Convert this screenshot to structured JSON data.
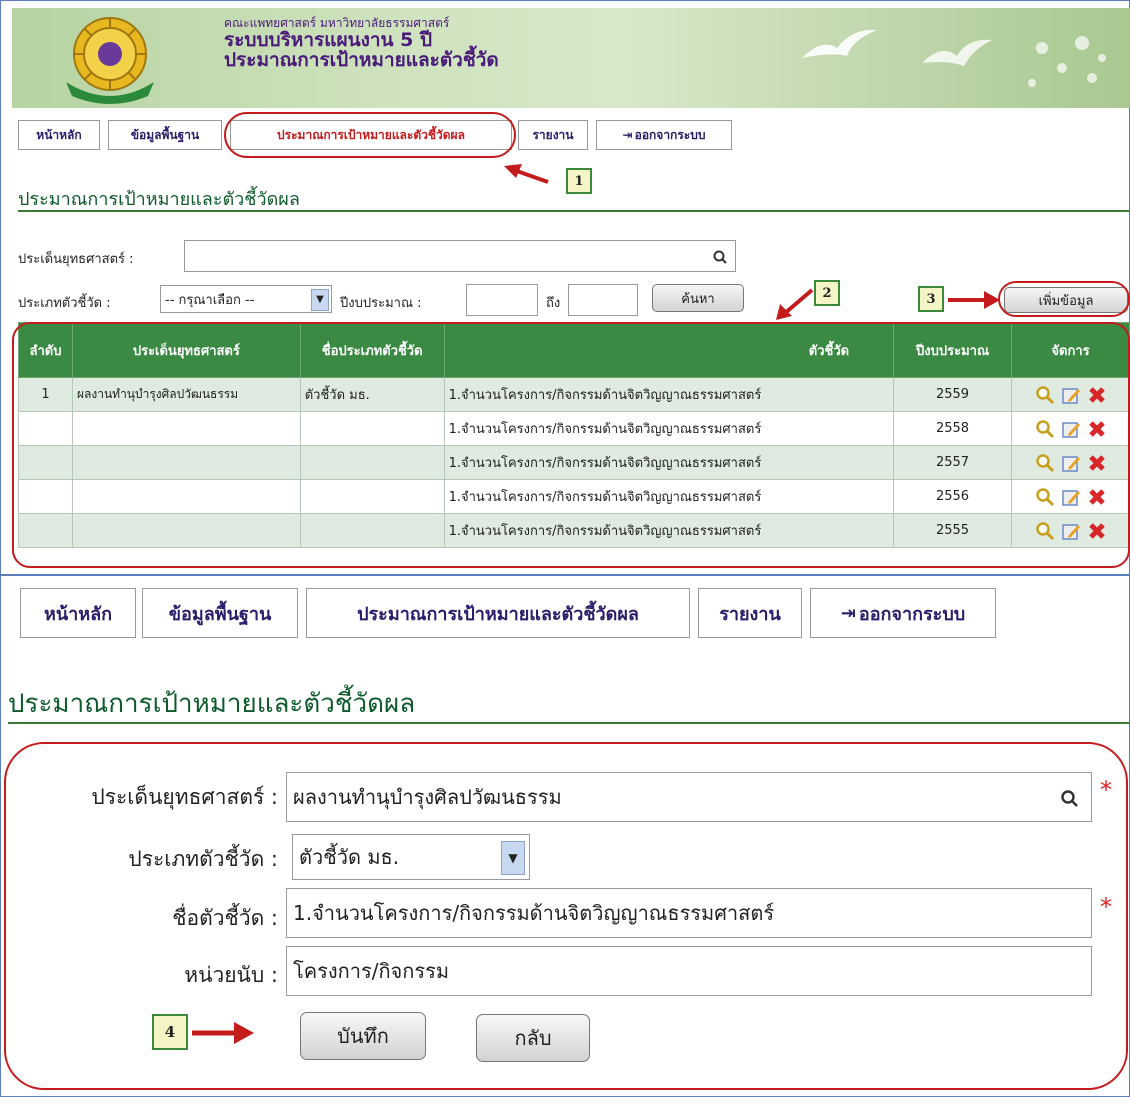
{
  "banner": {
    "faculty": "คณะแพทยศาสตร์ มหาวิทยาลัยธรรมศาสตร์",
    "system": "ระบบบริหารแผนงาน 5 ปี",
    "subtitle": "ประมาณการเป้าหมายและตัวชี้วัด"
  },
  "nav_small": [
    "หน้าหลัก",
    "ข้อมูลพื้นฐาน",
    "ประมาณการเป้าหมายและตัวชี้วัดผล",
    "รายงาน",
    "ออกจากระบบ"
  ],
  "list_page": {
    "title": "ประมาณการเป้าหมายและตัวชี้วัดผล",
    "strategy_label": "ประเด็นยุทธศาสตร์ :",
    "type_label": "ประเภทตัวชี้วัด :",
    "type_value": "-- กรุณาเลือก --",
    "year_label": "ปีงบประมาณ :",
    "to_label": "ถึง",
    "search_button": "ค้นหา",
    "add_button": "เพิ่มข้อมูล",
    "columns": [
      "ลำดับ",
      "ประเด็นยุทธศาสตร์",
      "ชื่อประเภทตัวชี้วัด",
      "ตัวชี้วัด",
      "ปีงบประมาณ",
      "จัดการ"
    ],
    "rows": [
      {
        "no": "1",
        "strategy": "ผลงานทำนุบำรุงศิลปวัฒนธรรม",
        "type": "ตัวชี้วัด มธ.",
        "indicator": "1.จำนวนโครงการ/กิจกรรมด้านจิตวิญญาณธรรมศาสตร์",
        "year": "2559"
      },
      {
        "no": "",
        "strategy": "",
        "type": "",
        "indicator": "1.จำนวนโครงการ/กิจกรรมด้านจิตวิญญาณธรรมศาสตร์",
        "year": "2558"
      },
      {
        "no": "",
        "strategy": "",
        "type": "",
        "indicator": "1.จำนวนโครงการ/กิจกรรมด้านจิตวิญญาณธรรมศาสตร์",
        "year": "2557"
      },
      {
        "no": "",
        "strategy": "",
        "type": "",
        "indicator": "1.จำนวนโครงการ/กิจกรรมด้านจิตวิญญาณธรรมศาสตร์",
        "year": "2556"
      },
      {
        "no": "",
        "strategy": "",
        "type": "",
        "indicator": "1.จำนวนโครงการ/กิจกรรมด้านจิตวิญญาณธรรมศาสตร์",
        "year": "2555"
      }
    ]
  },
  "nav_large": [
    "หน้าหลัก",
    "ข้อมูลพื้นฐาน",
    "ประมาณการเป้าหมายและตัวชี้วัดผล",
    "รายงาน",
    "ออกจากระบบ"
  ],
  "form_page": {
    "title": "ประมาณการเป้าหมายและตัวชี้วัดผล",
    "strategy_label": "ประเด็นยุทธศาสตร์ :",
    "strategy_value": "ผลงานทำนุบำรุงศิลปวัฒนธรรม",
    "type_label": "ประเภทตัวชี้วัด :",
    "type_value": "ตัวชี้วัด มธ.",
    "name_label": "ชื่อตัวชี้วัด :",
    "name_value": "1.จำนวนโครงการ/กิจกรรมด้านจิตวิญญาณธรรมศาสตร์",
    "unit_label": "หน่วยนับ :",
    "unit_value": "โครงการ/กิจกรรม",
    "save_button": "บันทึก",
    "back_button": "กลับ",
    "required_mark": "*"
  },
  "callouts": [
    "1",
    "2",
    "3",
    "4"
  ],
  "colors": {
    "header_green": "#3b8a44",
    "highlight_red": "#c41c1c",
    "title_green": "#0d5a2b",
    "nav_text": "#2b1d6b"
  }
}
